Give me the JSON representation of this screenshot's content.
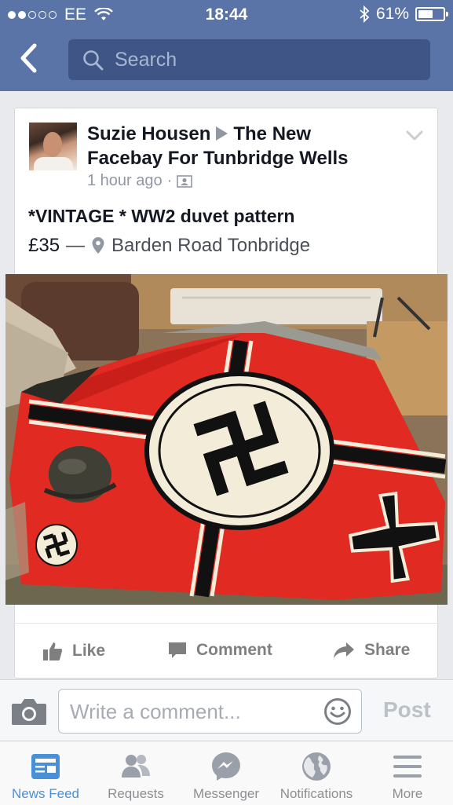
{
  "status_bar": {
    "carrier": "EE",
    "time": "18:44",
    "battery": "61%",
    "battery_level": 0.61
  },
  "nav": {
    "search_placeholder": "Search"
  },
  "post": {
    "author": "Suzie Housen",
    "group": "The New Facebay For Tunbridge Wells",
    "time_ago": "1 hour ago",
    "title": "*VINTAGE * WW2 duvet pattern",
    "price": "£35",
    "separator": "—",
    "location": "Barden Road Tonbridge"
  },
  "actions": {
    "like": "Like",
    "comment": "Comment",
    "share": "Share"
  },
  "composer": {
    "placeholder": "Write a comment...",
    "post": "Post"
  },
  "tabs": [
    {
      "label": "News Feed",
      "icon": "news-feed-icon",
      "active": true
    },
    {
      "label": "Requests",
      "icon": "friend-requests-icon",
      "active": false
    },
    {
      "label": "Messenger",
      "icon": "messenger-icon",
      "active": false
    },
    {
      "label": "Notifications",
      "icon": "globe-icon",
      "active": false
    },
    {
      "label": "More",
      "icon": "menu-icon",
      "active": false
    }
  ],
  "colors": {
    "header_blue": "#5b74a8",
    "search_bg": "#3e5585",
    "active_tab": "#4a90d9"
  }
}
